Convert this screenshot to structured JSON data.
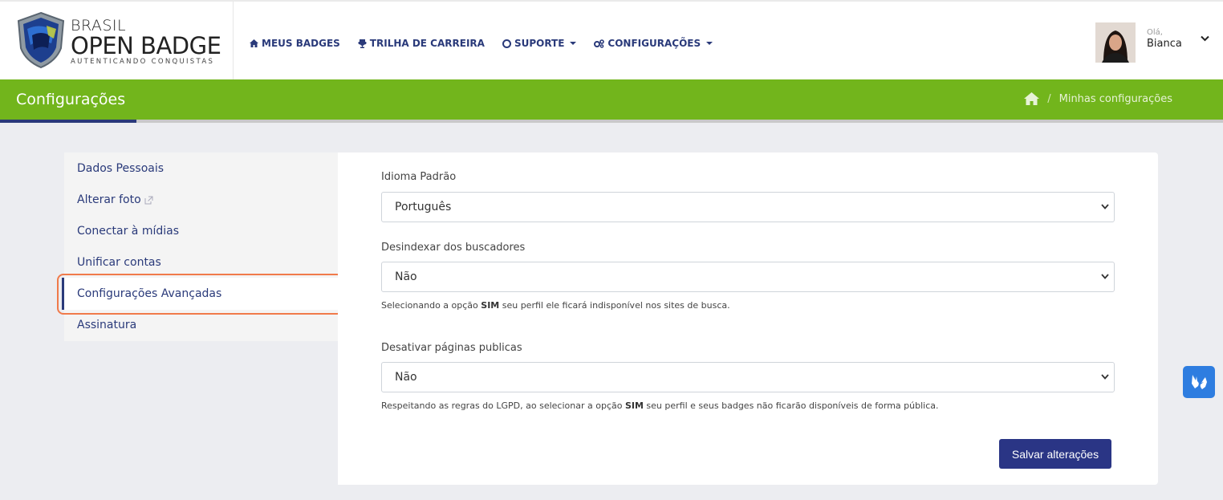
{
  "logo": {
    "line1": "BRASIL",
    "line2": "OPEN BADGE",
    "line3": "AUTENTICANDO CONQUISTAS"
  },
  "nav": {
    "items": [
      {
        "label": "MEUS BADGES",
        "icon": "home-icon"
      },
      {
        "label": "TRILHA DE CARREIRA",
        "icon": "trophy-icon"
      },
      {
        "label": "SUPORTE",
        "icon": "lifebuoy-icon",
        "dropdown": true
      },
      {
        "label": "CONFIGURAÇÕES",
        "icon": "gears-icon",
        "dropdown": true
      }
    ]
  },
  "user": {
    "greeting": "Olá,",
    "name": "Bianca"
  },
  "page": {
    "title": "Configurações",
    "breadcrumb": {
      "home_icon": "home-icon",
      "separator": "/",
      "current": "Minhas configurações"
    }
  },
  "sidebar": {
    "items": [
      {
        "label": "Dados Pessoais"
      },
      {
        "label": "Alterar foto",
        "icon": "external-link-icon"
      },
      {
        "label": "Conectar à mídias"
      },
      {
        "label": "Unificar contas"
      },
      {
        "label": "Configurações Avançadas",
        "active": true
      },
      {
        "label": "Assinatura"
      }
    ]
  },
  "form": {
    "idioma": {
      "label": "Idioma Padrão",
      "value": "Português"
    },
    "desindexar": {
      "label": "Desindexar dos buscadores",
      "value": "Não",
      "help_pre": "Selecionando a opção ",
      "help_bold": "SIM",
      "help_post": " seu perfil ele ficará indisponível nos sites de busca."
    },
    "desativar": {
      "label": "Desativar páginas publicas",
      "value": "Não",
      "help_pre": "Respeitando as regras do LGPD, ao selecionar a opção ",
      "help_bold": "SIM",
      "help_post": " seu perfil e seus badges não ficarão disponíveis de forma pública."
    },
    "save_label": "Salvar alterações"
  },
  "colors": {
    "brand_navy": "#2a3a7a",
    "header_green": "#72b51c",
    "button_blue": "#2a3585",
    "highlight_orange": "#f07a4a",
    "accessibility_blue": "#2e7de0"
  }
}
